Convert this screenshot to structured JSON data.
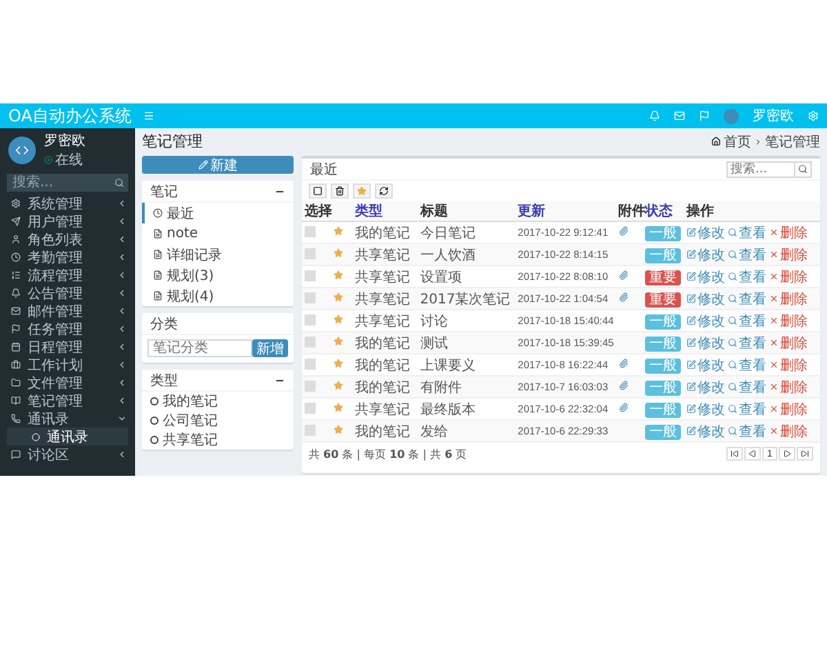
{
  "header": {
    "title": "OA自动办公系统",
    "user_name": "罗密欧"
  },
  "sidebar": {
    "user": {
      "name": "罗密欧",
      "status": "在线"
    },
    "search": {
      "placeholder": "搜索..."
    },
    "items": [
      {
        "label": "系统管理",
        "expanded": false
      },
      {
        "label": "用户管理",
        "expanded": false
      },
      {
        "label": "角色列表",
        "expanded": false
      },
      {
        "label": "考勤管理",
        "expanded": false
      },
      {
        "label": "流程管理",
        "expanded": false
      },
      {
        "label": "公告管理",
        "expanded": false
      },
      {
        "label": "邮件管理",
        "expanded": false
      },
      {
        "label": "任务管理",
        "expanded": false
      },
      {
        "label": "日程管理",
        "expanded": false
      },
      {
        "label": "工作计划",
        "expanded": false
      },
      {
        "label": "文件管理",
        "expanded": false
      },
      {
        "label": "笔记管理",
        "expanded": false
      },
      {
        "label": "通讯录",
        "expanded": true,
        "children": [
          {
            "label": "通讯录",
            "selected": true
          }
        ]
      },
      {
        "label": "讨论区",
        "expanded": false
      }
    ]
  },
  "page": {
    "title": "笔记管理",
    "breadcrumb": [
      "首页",
      "笔记管理"
    ]
  },
  "new_button": "新建",
  "notes_panel": {
    "title": "笔记",
    "items": [
      {
        "label": "最近",
        "selected": true
      },
      {
        "label": "note",
        "selected": false
      },
      {
        "label": "详细记录",
        "selected": false
      },
      {
        "label": "规划(3)",
        "selected": false
      },
      {
        "label": "规划(4)",
        "selected": false
      }
    ]
  },
  "category_panel": {
    "title": "分类",
    "placeholder": "笔记分类",
    "button": "新增"
  },
  "types_panel": {
    "title": "类型",
    "items": [
      "我的笔记",
      "公司笔记",
      "共享笔记"
    ]
  },
  "table_panel": {
    "title": "最近",
    "search": {
      "placeholder": "搜索..."
    },
    "columns": [
      {
        "label": "选择",
        "sortable": false
      },
      {
        "label": "类型",
        "sortable": true
      },
      {
        "label": "标题",
        "sortable": false
      },
      {
        "label": "更新",
        "sortable": true
      },
      {
        "label": "附件",
        "sortable": false
      },
      {
        "label": "状态",
        "sortable": true
      },
      {
        "label": "操作",
        "sortable": false
      }
    ],
    "rows": [
      {
        "checked": false,
        "starred": true,
        "type": "我的笔记",
        "title": "今日笔记",
        "updated": "2017-10-22 9:12:41",
        "attachment": true,
        "status": {
          "label": "一般",
          "kind": "normal"
        },
        "actions": [
          "修改",
          "查看",
          "删除"
        ]
      },
      {
        "checked": false,
        "starred": true,
        "type": "共享笔记",
        "title": "一人饮酒",
        "updated": "2017-10-22 8:14:15",
        "attachment": false,
        "status": {
          "label": "一般",
          "kind": "normal"
        },
        "actions": [
          "修改",
          "查看",
          "删除"
        ]
      },
      {
        "checked": false,
        "starred": true,
        "type": "共享笔记",
        "title": "设置项",
        "updated": "2017-10-22 8:08:10",
        "attachment": true,
        "status": {
          "label": "重要",
          "kind": "important"
        },
        "actions": [
          "修改",
          "查看",
          "删除"
        ]
      },
      {
        "checked": false,
        "starred": true,
        "type": "共享笔记",
        "title": "2017某次笔记",
        "updated": "2017-10-22 1:04:54",
        "attachment": true,
        "status": {
          "label": "重要",
          "kind": "important"
        },
        "actions": [
          "修改",
          "查看",
          "删除"
        ]
      },
      {
        "checked": false,
        "starred": true,
        "type": "共享笔记",
        "title": "讨论",
        "updated": "2017-10-18 15:40:44",
        "attachment": false,
        "status": {
          "label": "一般",
          "kind": "normal"
        },
        "actions": [
          "修改",
          "查看",
          "删除"
        ]
      },
      {
        "checked": false,
        "starred": true,
        "type": "我的笔记",
        "title": "测试",
        "updated": "2017-10-18 15:39:45",
        "attachment": false,
        "status": {
          "label": "一般",
          "kind": "normal"
        },
        "actions": [
          "修改",
          "查看",
          "删除"
        ]
      },
      {
        "checked": false,
        "starred": true,
        "type": "我的笔记",
        "title": "上课要义",
        "updated": "2017-10-8 16:22:44",
        "attachment": true,
        "status": {
          "label": "一般",
          "kind": "normal"
        },
        "actions": [
          "修改",
          "查看",
          "删除"
        ]
      },
      {
        "checked": false,
        "starred": true,
        "type": "我的笔记",
        "title": "有附件",
        "updated": "2017-10-7 16:03:03",
        "attachment": true,
        "status": {
          "label": "一般",
          "kind": "normal"
        },
        "actions": [
          "修改",
          "查看",
          "删除"
        ]
      },
      {
        "checked": false,
        "starred": true,
        "type": "共享笔记",
        "title": "最终版本",
        "updated": "2017-10-6 22:32:04",
        "attachment": true,
        "status": {
          "label": "一般",
          "kind": "normal"
        },
        "actions": [
          "修改",
          "查看",
          "删除"
        ]
      },
      {
        "checked": false,
        "starred": true,
        "type": "我的笔记",
        "title": "发给",
        "updated": "2017-10-6 22:29:33",
        "attachment": false,
        "status": {
          "label": "一般",
          "kind": "normal"
        },
        "actions": [
          "修改",
          "查看",
          "删除"
        ]
      }
    ],
    "footer": "共 **60** 条 | 每页 **10** 条 | 共 **6** 页",
    "pagination": {
      "page": "1"
    }
  }
}
